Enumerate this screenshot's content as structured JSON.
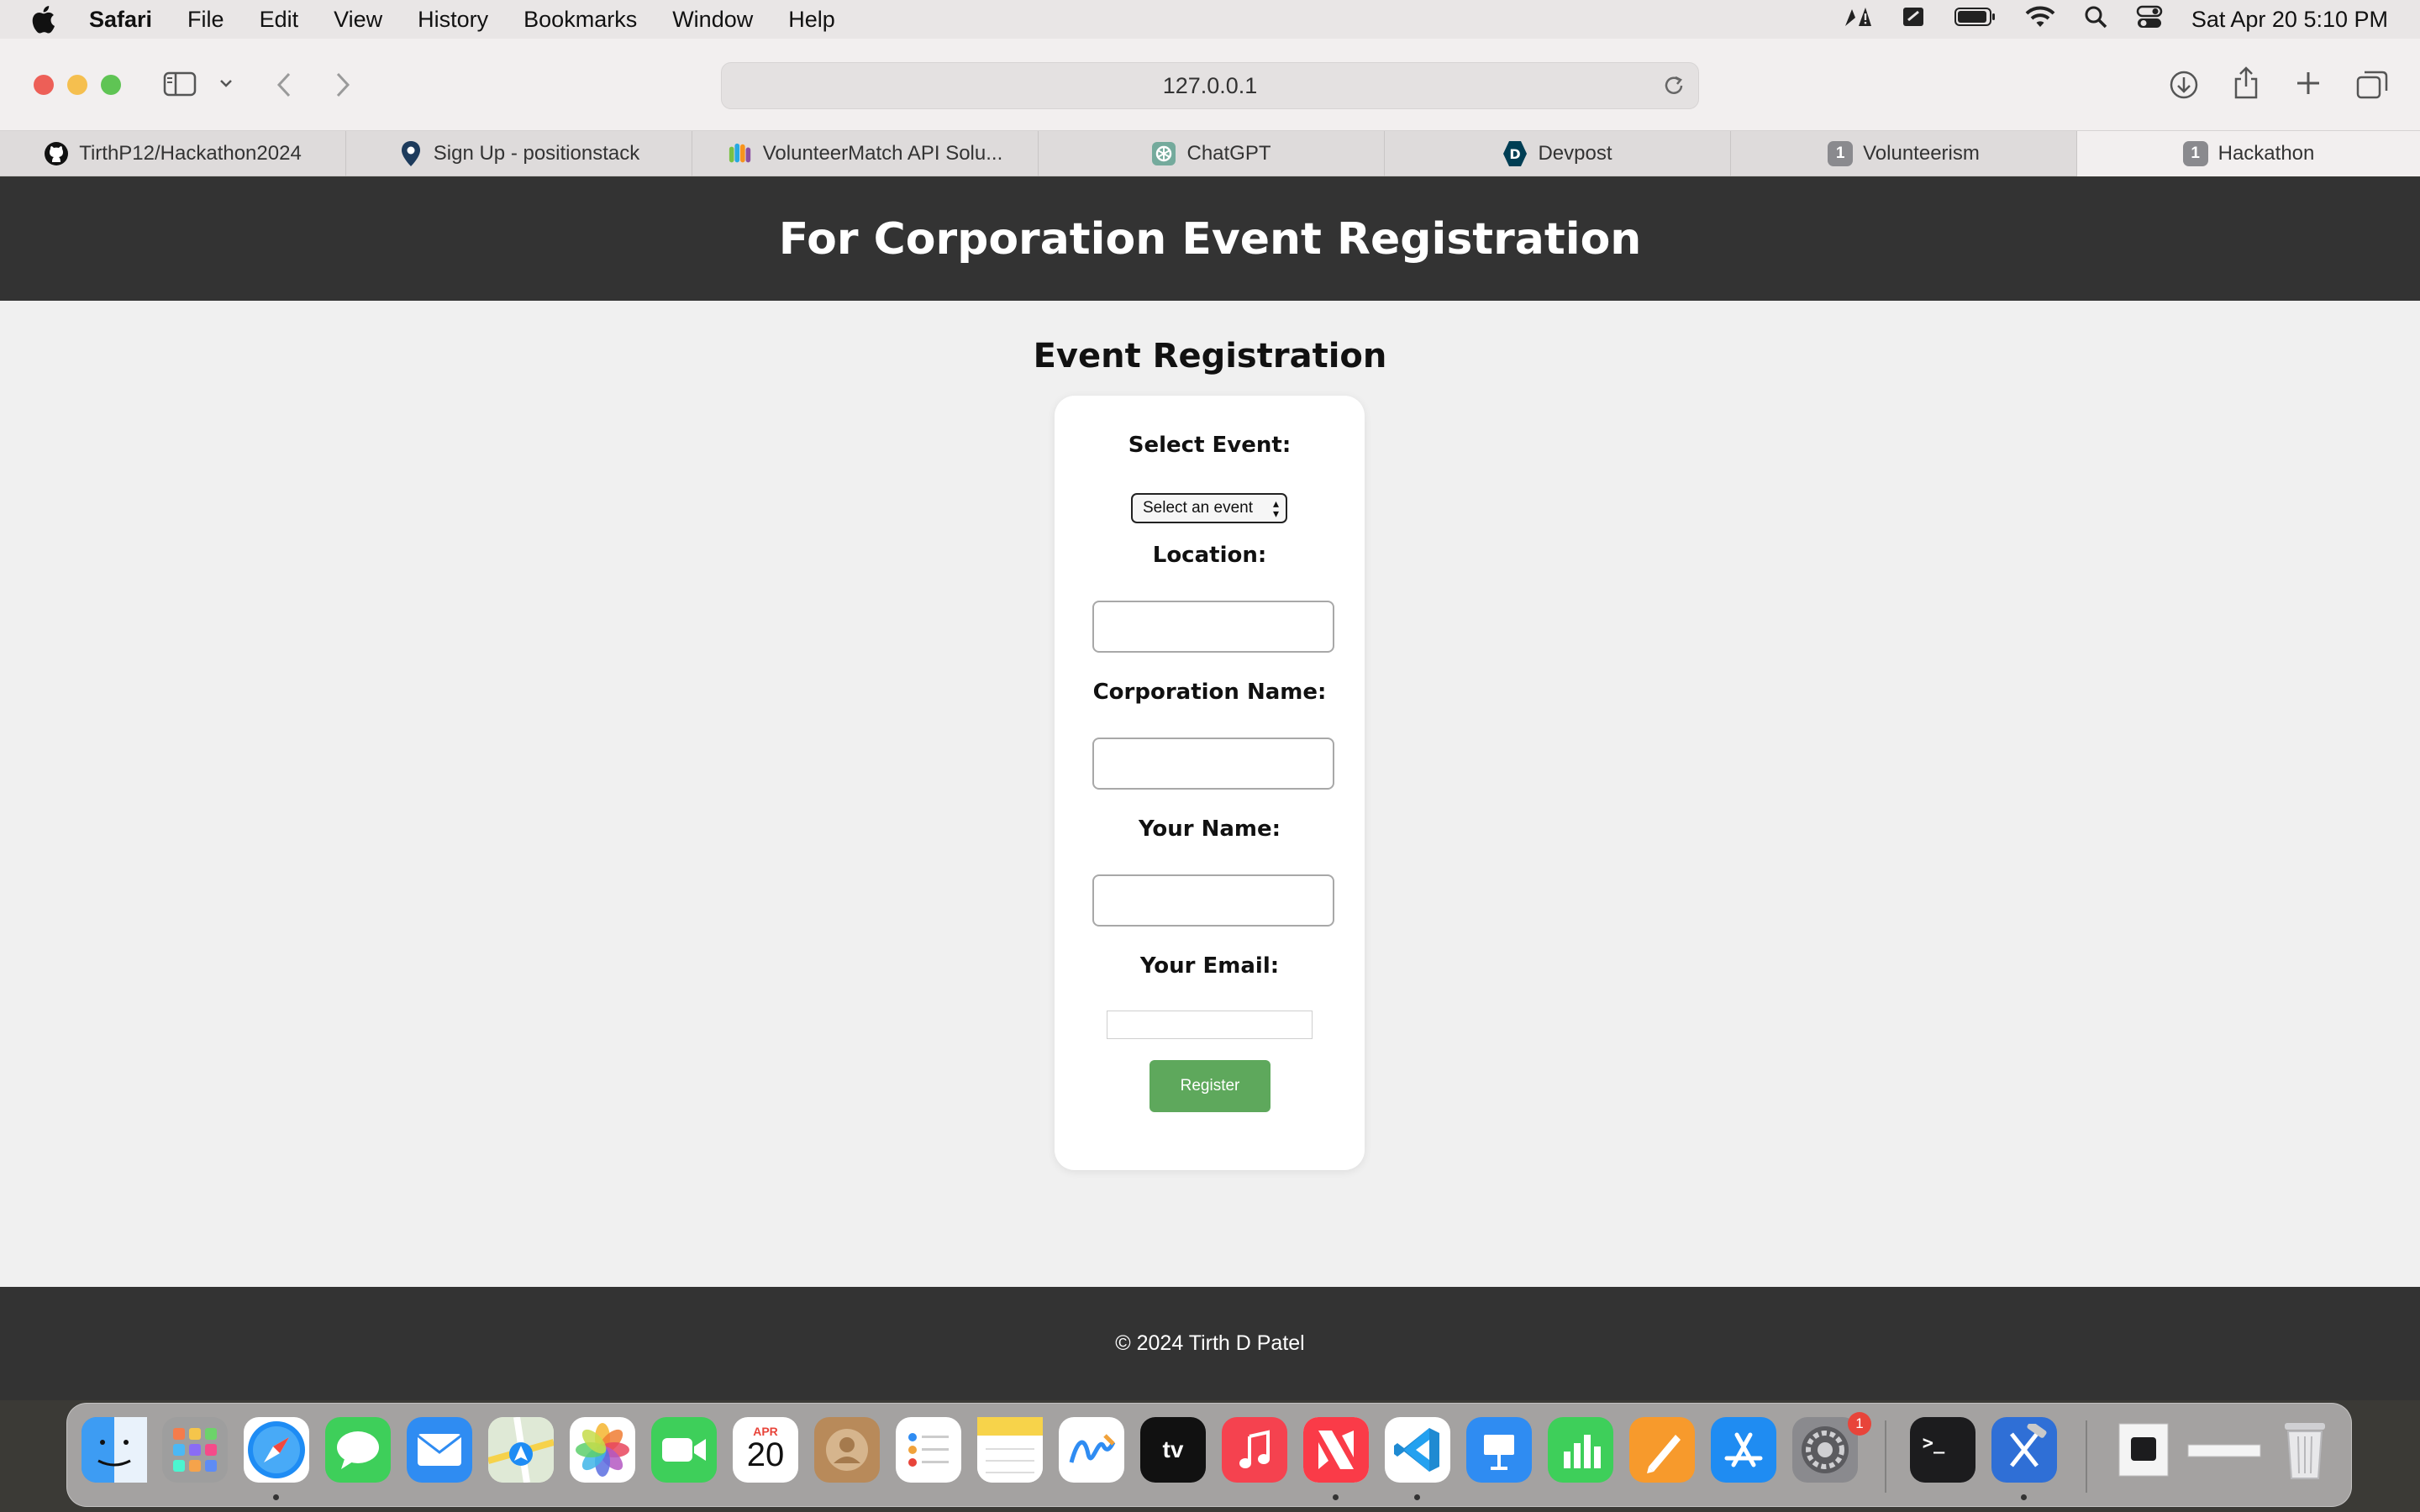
{
  "menubar": {
    "app_name": "Safari",
    "items": [
      "File",
      "Edit",
      "View",
      "History",
      "Bookmarks",
      "Window",
      "Help"
    ],
    "clock": "Sat Apr 20  5:10 PM"
  },
  "browser": {
    "url": "127.0.0.1",
    "tabs": [
      {
        "label": "TirthP12/Hackathon2024",
        "icon": "github-icon"
      },
      {
        "label": "Sign Up - positionstack",
        "icon": "map-pin-icon"
      },
      {
        "label": "VolunteerMatch API Solu...",
        "icon": "volunteermatch-icon"
      },
      {
        "label": "ChatGPT",
        "icon": "chatgpt-icon"
      },
      {
        "label": "Devpost",
        "icon": "devpost-icon"
      },
      {
        "label": "Volunteerism",
        "icon": "number-badge-icon",
        "badge": "1"
      },
      {
        "label": "Hackathon",
        "icon": "number-badge-icon",
        "badge": "1",
        "active": true
      }
    ]
  },
  "page": {
    "header_title": "For Corporation Event Registration",
    "section_title": "Event Registration",
    "form": {
      "select_event_label": "Select Event:",
      "select_event_value": "Select an event",
      "location_label": "Location:",
      "corporation_label": "Corporation Name:",
      "your_name_label": "Your Name:",
      "your_email_label": "Your Email:",
      "register_label": "Register",
      "register_color": "#5ea85c"
    },
    "footer": "© 2024 Tirth D Patel"
  },
  "dock": {
    "calendar_month": "APR",
    "calendar_day": "20",
    "settings_badge": "1"
  }
}
